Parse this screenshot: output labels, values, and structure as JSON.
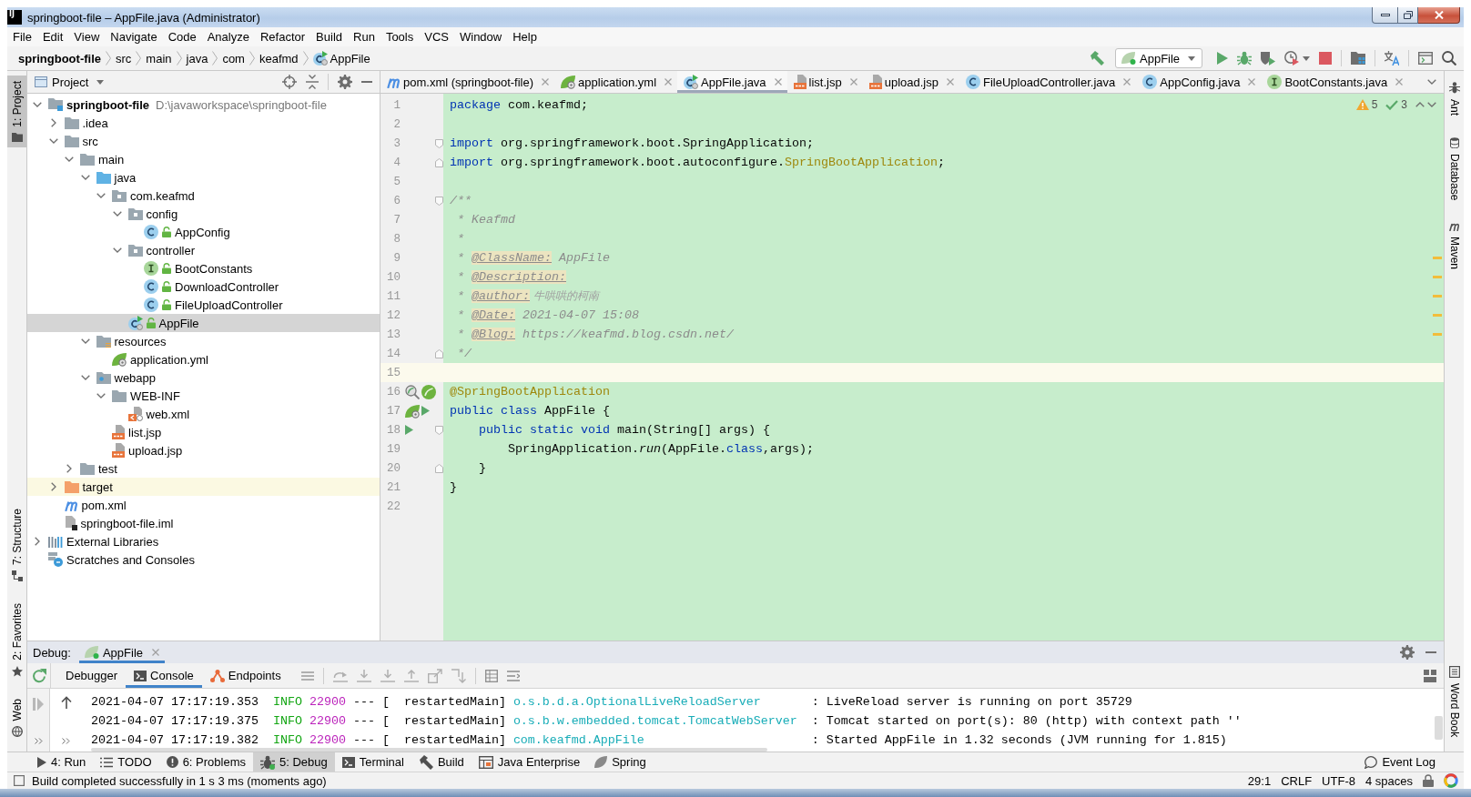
{
  "window": {
    "logo": "IJ",
    "title": "springboot-file – AppFile.java (Administrator)"
  },
  "menu": [
    "File",
    "Edit",
    "View",
    "Navigate",
    "Code",
    "Analyze",
    "Refactor",
    "Build",
    "Run",
    "Tools",
    "VCS",
    "Window",
    "Help"
  ],
  "breadcrumb": [
    {
      "label": "springboot-file",
      "kind": "project"
    },
    {
      "label": "src",
      "kind": "dir"
    },
    {
      "label": "main",
      "kind": "dir"
    },
    {
      "label": "java",
      "kind": "dir"
    },
    {
      "label": "com",
      "kind": "dir"
    },
    {
      "label": "keafmd",
      "kind": "dir"
    },
    {
      "label": "AppFile",
      "kind": "boot-class"
    }
  ],
  "run_config": {
    "label": "AppFile"
  },
  "left_stripe": {
    "top": [
      {
        "label": "1: Project",
        "kind": "project",
        "selected": true
      }
    ],
    "bottom": [
      {
        "label": "7: Structure",
        "kind": "structure",
        "selected": false
      },
      {
        "label": "2: Favorites",
        "kind": "favorites",
        "selected": false
      },
      {
        "label": "Web",
        "kind": "web",
        "selected": false
      }
    ]
  },
  "right_stripe": {
    "top": [
      {
        "label": "Ant",
        "kind": "ant",
        "selected": false
      },
      {
        "label": "Database",
        "kind": "database",
        "selected": false
      },
      {
        "label": "Maven",
        "kind": "maven",
        "selected": false
      }
    ],
    "bottom": [
      {
        "label": "Word Book",
        "kind": "book",
        "selected": false
      }
    ]
  },
  "project_panel": {
    "title": "Project",
    "tree": [
      {
        "label": "springboot-file",
        "hint": "D:\\javaworkspace\\springboot-file",
        "kind": "module",
        "expanded": true,
        "selected": false,
        "children": [
          {
            "label": ".idea",
            "kind": "folder",
            "expanded": false,
            "selected": false
          },
          {
            "label": "src",
            "kind": "folder",
            "expanded": true,
            "selected": false,
            "children": [
              {
                "label": "main",
                "kind": "folder",
                "expanded": true,
                "selected": false,
                "children": [
                  {
                    "label": "java",
                    "kind": "source-folder",
                    "expanded": true,
                    "selected": false,
                    "children": [
                      {
                        "label": "com.keafmd",
                        "kind": "package",
                        "expanded": true,
                        "selected": false,
                        "children": [
                          {
                            "label": "config",
                            "kind": "package",
                            "expanded": true,
                            "selected": false,
                            "children": [
                              {
                                "label": "AppConfig",
                                "kind": "class",
                                "selected": false
                              }
                            ]
                          },
                          {
                            "label": "controller",
                            "kind": "package",
                            "expanded": true,
                            "selected": false,
                            "children": [
                              {
                                "label": "BootConstants",
                                "kind": "interface",
                                "selected": false
                              },
                              {
                                "label": "DownloadController",
                                "kind": "class",
                                "selected": false
                              },
                              {
                                "label": "FileUploadController",
                                "kind": "class",
                                "selected": false
                              }
                            ]
                          },
                          {
                            "label": "AppFile",
                            "kind": "boot-class",
                            "selected": true
                          }
                        ]
                      }
                    ]
                  },
                  {
                    "label": "resources",
                    "kind": "resources-folder",
                    "expanded": true,
                    "selected": false,
                    "children": [
                      {
                        "label": "application.yml",
                        "kind": "spring-yaml",
                        "selected": false
                      }
                    ]
                  },
                  {
                    "label": "webapp",
                    "kind": "web-folder",
                    "expanded": true,
                    "selected": false,
                    "children": [
                      {
                        "label": "WEB-INF",
                        "kind": "folder",
                        "expanded": true,
                        "selected": false,
                        "children": [
                          {
                            "label": "web.xml",
                            "kind": "xml",
                            "selected": false
                          }
                        ]
                      },
                      {
                        "label": "list.jsp",
                        "kind": "jsp",
                        "selected": false
                      },
                      {
                        "label": "upload.jsp",
                        "kind": "jsp",
                        "selected": false
                      }
                    ]
                  }
                ]
              },
              {
                "label": "test",
                "kind": "folder",
                "expanded": false,
                "selected": false
              }
            ]
          },
          {
            "label": "target",
            "kind": "excluded-folder",
            "expanded": false,
            "selected": false
          },
          {
            "label": "pom.xml",
            "kind": "maven",
            "selected": false
          },
          {
            "label": "springboot-file.iml",
            "kind": "iml",
            "selected": false
          }
        ]
      },
      {
        "label": "External Libraries",
        "kind": "libraries",
        "expanded": false,
        "selected": false
      },
      {
        "label": "Scratches and Consoles",
        "kind": "scratches",
        "selected": false
      }
    ]
  },
  "editor": {
    "tabs": [
      {
        "label": "pom.xml (springboot-file)",
        "kind": "maven",
        "selected": false
      },
      {
        "label": "application.yml",
        "kind": "spring-yaml",
        "selected": false
      },
      {
        "label": "AppFile.java",
        "kind": "boot-class",
        "selected": true
      },
      {
        "label": "list.jsp",
        "kind": "jsp",
        "selected": false
      },
      {
        "label": "upload.jsp",
        "kind": "jsp",
        "selected": false
      },
      {
        "label": "FileUploadController.java",
        "kind": "class",
        "selected": false
      },
      {
        "label": "AppConfig.java",
        "kind": "class",
        "selected": false
      },
      {
        "label": "BootConstants.java",
        "kind": "interface",
        "selected": false
      }
    ],
    "inspections": {
      "warnings": "5",
      "typos": "3"
    },
    "lines": [
      {
        "number": "1",
        "current": false,
        "warning": false,
        "tokens": [
          {
            "kind": "keyword",
            "text": "package"
          },
          {
            "kind": "plain",
            "text": " com.keafmd;"
          }
        ]
      },
      {
        "number": "2",
        "current": false,
        "warning": false
      },
      {
        "number": "3",
        "current": false,
        "warning": false,
        "fold": {
          "kind": "start"
        },
        "tokens": [
          {
            "kind": "keyword",
            "text": "import"
          },
          {
            "kind": "plain",
            "text": " org.springframework.boot.SpringApplication;"
          }
        ]
      },
      {
        "number": "4",
        "current": false,
        "warning": false,
        "fold": {
          "kind": "end"
        },
        "tokens": [
          {
            "kind": "keyword",
            "text": "import"
          },
          {
            "kind": "plain",
            "text": " org.springframework.boot.autoconfigure."
          },
          {
            "kind": "annotation",
            "text": "SpringBootApplication"
          },
          {
            "kind": "plain",
            "text": ";"
          }
        ]
      },
      {
        "number": "5",
        "current": false,
        "warning": false
      },
      {
        "number": "6",
        "current": false,
        "warning": false,
        "fold": {
          "kind": "start"
        },
        "tokens": [
          {
            "kind": "comment",
            "text": "/**"
          }
        ]
      },
      {
        "number": "7",
        "current": false,
        "warning": false,
        "tokens": [
          {
            "kind": "comment",
            "text": " * Keafmd"
          }
        ]
      },
      {
        "number": "8",
        "current": false,
        "warning": false,
        "tokens": [
          {
            "kind": "comment",
            "text": " *"
          }
        ]
      },
      {
        "number": "9",
        "current": false,
        "warning": true,
        "tokens": [
          {
            "kind": "comment",
            "text": " * "
          },
          {
            "kind": "doctag",
            "text": "@ClassName:"
          },
          {
            "kind": "comment",
            "text": " AppFile"
          }
        ]
      },
      {
        "number": "10",
        "current": false,
        "warning": true,
        "tokens": [
          {
            "kind": "comment",
            "text": " * "
          },
          {
            "kind": "doctag",
            "text": "@Description:"
          }
        ]
      },
      {
        "number": "11",
        "current": false,
        "warning": true,
        "tokens": [
          {
            "kind": "comment",
            "text": " * "
          },
          {
            "kind": "doctag",
            "text": "@author:"
          },
          {
            "kind": "cjk",
            "text": " 牛哄哄的柯南"
          }
        ]
      },
      {
        "number": "12",
        "current": false,
        "warning": true,
        "tokens": [
          {
            "kind": "comment",
            "text": " * "
          },
          {
            "kind": "doctag",
            "text": "@Date:"
          },
          {
            "kind": "comment",
            "text": " 2021-04-07 15:08"
          }
        ]
      },
      {
        "number": "13",
        "current": false,
        "warning": true,
        "tokens": [
          {
            "kind": "comment",
            "text": " * "
          },
          {
            "kind": "doctag",
            "text": "@Blog:"
          },
          {
            "kind": "comment",
            "text": " https://keafmd.blog.csdn.net/"
          }
        ]
      },
      {
        "number": "14",
        "current": false,
        "warning": false,
        "fold": {
          "kind": "end"
        },
        "tokens": [
          {
            "kind": "comment",
            "text": " */"
          }
        ]
      },
      {
        "number": "15",
        "current": true,
        "warning": false
      },
      {
        "number": "16",
        "current": false,
        "warning": false,
        "gutter": [
          {
            "kind": "bean-search"
          },
          {
            "kind": "bean"
          }
        ],
        "tokens": [
          {
            "kind": "annotation",
            "text": "@SpringBootApplication"
          }
        ]
      },
      {
        "number": "17",
        "current": false,
        "warning": false,
        "gutter": [
          {
            "kind": "boot"
          },
          {
            "kind": "run"
          }
        ],
        "tokens": [
          {
            "kind": "keyword",
            "text": "public"
          },
          {
            "kind": "keyword",
            "text": " class"
          },
          {
            "kind": "plain",
            "text": " AppFile {"
          }
        ]
      },
      {
        "number": "18",
        "current": false,
        "warning": false,
        "gutter": [
          {
            "kind": "run"
          }
        ],
        "fold": {
          "kind": "start"
        },
        "tokens": [
          {
            "kind": "keyword",
            "text": "    public"
          },
          {
            "kind": "keyword",
            "text": " static"
          },
          {
            "kind": "keyword",
            "text": " void"
          },
          {
            "kind": "plain",
            "text": " main(String[] args) {"
          }
        ]
      },
      {
        "number": "19",
        "current": false,
        "warning": false,
        "tokens": [
          {
            "kind": "plain",
            "text": "        SpringApplication."
          },
          {
            "kind": "static-call",
            "text": "run"
          },
          {
            "kind": "plain",
            "text": "(AppFile."
          },
          {
            "kind": "keyword",
            "text": "class"
          },
          {
            "kind": "plain",
            "text": ",args);"
          }
        ]
      },
      {
        "number": "20",
        "current": false,
        "warning": false,
        "fold": {
          "kind": "end"
        },
        "tokens": [
          {
            "kind": "plain",
            "text": "    }"
          }
        ]
      },
      {
        "number": "21",
        "current": false,
        "warning": false,
        "tokens": [
          {
            "kind": "plain",
            "text": "}"
          }
        ]
      },
      {
        "number": "22",
        "current": false,
        "warning": false
      }
    ]
  },
  "debug": {
    "title": "Debug:",
    "sessions": [
      {
        "label": "AppFile",
        "kind": "boot",
        "selected": true
      }
    ],
    "tabs": [
      {
        "label": "Debugger",
        "kind": "plain",
        "selected": false
      },
      {
        "label": "Console",
        "kind": "console",
        "selected": true
      },
      {
        "label": "Endpoints",
        "kind": "endpoints",
        "selected": false
      }
    ],
    "console": [
      {
        "segments": [
          {
            "kind": "time",
            "text": "2021-04-07 17:17:19.353"
          },
          {
            "kind": "level",
            "text": "INFO"
          },
          {
            "kind": "pid",
            "text": "22900"
          },
          {
            "kind": "thread",
            "text": "--- [  restartedMain]"
          },
          {
            "kind": "logger",
            "text": "o.s.b.d.a.OptionalLiveReloadServer"
          },
          {
            "kind": "message",
            "text": ": LiveReload server is running on port 35729"
          }
        ]
      },
      {
        "segments": [
          {
            "kind": "time",
            "text": "2021-04-07 17:17:19.375"
          },
          {
            "kind": "level",
            "text": "INFO"
          },
          {
            "kind": "pid",
            "text": "22900"
          },
          {
            "kind": "thread",
            "text": "--- [  restartedMain]"
          },
          {
            "kind": "logger",
            "text": "o.s.b.w.embedded.tomcat.TomcatWebServer"
          },
          {
            "kind": "message",
            "text": ": Tomcat started on port(s): 80 (http) with context path ''"
          }
        ]
      },
      {
        "segments": [
          {
            "kind": "time",
            "text": "2021-04-07 17:17:19.382"
          },
          {
            "kind": "level",
            "text": "INFO"
          },
          {
            "kind": "pid",
            "text": "22900"
          },
          {
            "kind": "thread",
            "text": "--- [  restartedMain]"
          },
          {
            "kind": "logger",
            "text": "com.keafmd.AppFile"
          },
          {
            "kind": "message",
            "text": ": Started AppFile in 1.32 seconds (JVM running for 1.815)"
          }
        ]
      }
    ]
  },
  "bottom_bar": {
    "tools": [
      {
        "label": "4: Run",
        "kind": "run",
        "selected": false
      },
      {
        "label": "TODO",
        "kind": "todo",
        "selected": false
      },
      {
        "label": "6: Problems",
        "kind": "problems",
        "selected": false
      },
      {
        "label": "5: Debug",
        "kind": "debug",
        "selected": true
      },
      {
        "label": "Terminal",
        "kind": "terminal",
        "selected": false
      },
      {
        "label": "Build",
        "kind": "build",
        "selected": false
      },
      {
        "label": "Java Enterprise",
        "kind": "enterprise",
        "selected": false
      },
      {
        "label": "Spring",
        "kind": "spring",
        "selected": false
      }
    ],
    "event_log": "Event Log"
  },
  "status_bar": {
    "message": "Build completed successfully in 1 s 3 ms (moments ago)",
    "items": [
      "29:1",
      "CRLF",
      "UTF-8",
      "4 spaces"
    ]
  }
}
